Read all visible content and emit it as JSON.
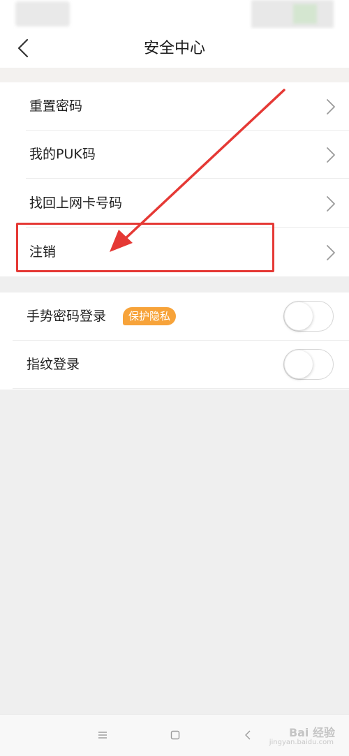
{
  "header": {
    "title": "安全中心",
    "back_icon": "chevron-left-icon"
  },
  "account_settings": {
    "items": [
      {
        "label": "重置密码",
        "icon": "chevron-right-icon"
      },
      {
        "label": "我的PUK码",
        "icon": "chevron-right-icon"
      },
      {
        "label": "找回上网卡号码",
        "icon": "chevron-right-icon"
      },
      {
        "label": "注销",
        "icon": "chevron-right-icon"
      }
    ]
  },
  "login_settings": {
    "items": [
      {
        "label": "手势密码登录",
        "badge": "保护隐私",
        "enabled": false
      },
      {
        "label": "指纹登录",
        "enabled": false
      }
    ]
  },
  "annotation": {
    "highlight_color": "#e53935",
    "highlighted_item": "注销"
  },
  "nav_bar": {
    "icons": [
      "menu-icon",
      "home-square-icon",
      "back-triangle-icon"
    ]
  },
  "watermark": {
    "text": "Bai 经验",
    "subtext": "jingyan.baidu.com"
  },
  "colors": {
    "badge": "#f7a33a",
    "background": "#efefef",
    "annotation_red": "#e53935"
  }
}
